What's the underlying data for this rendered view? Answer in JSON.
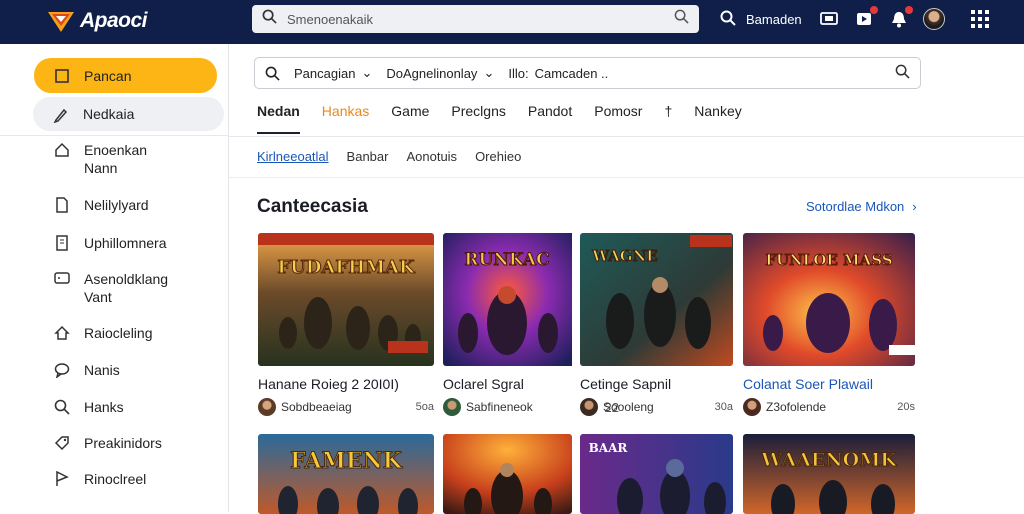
{
  "header": {
    "logo_text": "Apaoci",
    "search_placeholder": "Smenoenakaik",
    "user_name": "Bamaden"
  },
  "sidebar": {
    "items": [
      {
        "label": "Pancan",
        "icon": "square-icon"
      },
      {
        "label": "Nedkaia",
        "icon": "pen-icon"
      },
      {
        "label": "Enoenkan Nann",
        "icon": "home-icon"
      },
      {
        "label": "Nelilylyard",
        "icon": "file-icon"
      },
      {
        "label": "Uphillomnera",
        "icon": "document-icon"
      },
      {
        "label": "Asenoldklang Vant",
        "icon": "chat-icon"
      },
      {
        "label": "Raiocleling",
        "icon": "house-icon"
      },
      {
        "label": "Nanis",
        "icon": "speech-icon"
      },
      {
        "label": "Hanks",
        "icon": "search-icon"
      },
      {
        "label": "Preakinidors",
        "icon": "tag-icon"
      },
      {
        "label": "Rinoclreel",
        "icon": "flag-icon"
      }
    ]
  },
  "filter_bar": {
    "segment_1": "Pancagian",
    "segment_2": "DoAgnelinonlay",
    "segment_3_prefix": "Illo:",
    "segment_3_value": "Camcaden .."
  },
  "tabs": [
    "Nedan",
    "Hankas",
    "Game",
    "Preclgns",
    "Pandot",
    "Pomosr",
    "†",
    "Nankey"
  ],
  "subtabs": [
    "Kirlneeoatlal",
    "Banbar",
    "Aonotuis",
    "Orehieo"
  ],
  "section": {
    "title": "Canteecasia",
    "see_more": "Sotordlae Mdkon"
  },
  "cards": [
    {
      "title": "Hanane Roieg 2 20I0I)",
      "channel": "Sobdbeaeiag",
      "count": "5oa",
      "thumb_text": "FUDAFHMAK",
      "title_color": "#1b1d26"
    },
    {
      "title": "Oclarel Sgral",
      "channel": "Sabfineneok",
      "count": "22",
      "thumb_text": "RUNKAC",
      "title_color": "#1b1d26"
    },
    {
      "title": "Cetinge Sapnil",
      "channel": "Soooleng",
      "count": "30a",
      "thumb_text": "WAGNE",
      "title_color": "#1b1d26"
    },
    {
      "title": "Colanat Soer Plawail",
      "channel": "Z3ofolende",
      "count": "20s",
      "thumb_text": "FUNLOE MASS",
      "title_color": "#1a56b8"
    }
  ],
  "cards_row2": [
    {
      "thumb_text": "FAMENK"
    },
    {
      "thumb_text": ""
    },
    {
      "thumb_text": "BAAR"
    },
    {
      "thumb_text": "WAAENOMK"
    }
  ]
}
